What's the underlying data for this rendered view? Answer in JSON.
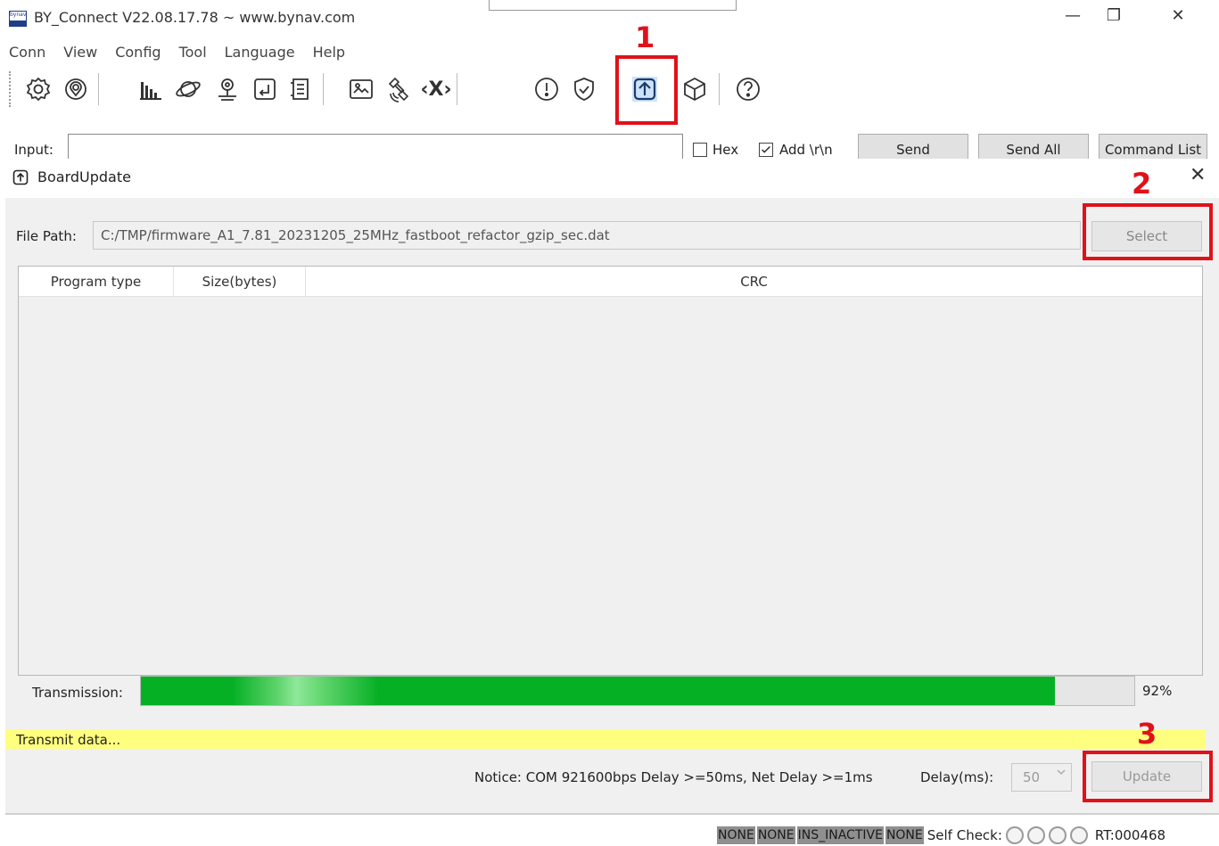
{
  "window": {
    "title": "BY_Connect V22.08.17.78 ~ www.bynav.com",
    "logo_text": "bynav",
    "minimize_glyph": "—",
    "maximize_glyph": "❐",
    "close_glyph": "✕"
  },
  "menu": {
    "items": [
      "Conn",
      "View",
      "Config",
      "Tool",
      "Language",
      "Help"
    ]
  },
  "toolbar": {
    "icons": [
      "gear-icon",
      "location-icon",
      "bar-chart-icon",
      "planet-icon",
      "map-pin-icon",
      "terminal-icon",
      "list-icon",
      "image-icon",
      "satellite-icon",
      "x-command-icon",
      "alert-icon",
      "shield-icon",
      "upload-icon",
      "cube-icon",
      "help-icon"
    ],
    "x_glyph": "‹X›"
  },
  "annotations": {
    "step1": "1",
    "step2": "2",
    "step3": "3",
    "highlight_color": "#e0111a"
  },
  "input_row": {
    "label": "Input:",
    "hex_label": "Hex",
    "crlf_label": "Add \\r\\n",
    "hex_checked": false,
    "crlf_checked": true,
    "send_label": "Send",
    "send_all_label": "Send All",
    "command_list_label": "Command List"
  },
  "dialog": {
    "title": "BoardUpdate",
    "close_glyph": "✕",
    "file_path_label": "File Path:",
    "file_path_value": "C:/TMP/firmware_A1_7.81_20231205_25MHz_fastboot_refactor_gzip_sec.dat",
    "select_label": "Select",
    "table": {
      "columns": [
        "Program type",
        "Size(bytes)",
        "CRC"
      ],
      "rows": []
    },
    "transmission_label": "Transmission:",
    "progress_percent": 92,
    "progress_text": "92%",
    "progress_color": "#06b025",
    "status_text": "Transmit data...",
    "status_bg": "#ffff7f",
    "notice_text": "Notice: COM 921600bps Delay >=50ms, Net Delay >=1ms",
    "delay_label": "Delay(ms):",
    "delay_value": "50",
    "update_label": "Update"
  },
  "status_bar": {
    "tags": [
      "NONE",
      "NONE",
      "INS_INACTIVE",
      "NONE"
    ],
    "self_check_label": "Self Check:",
    "led_count": 4,
    "rt_text": "RT:000468"
  }
}
